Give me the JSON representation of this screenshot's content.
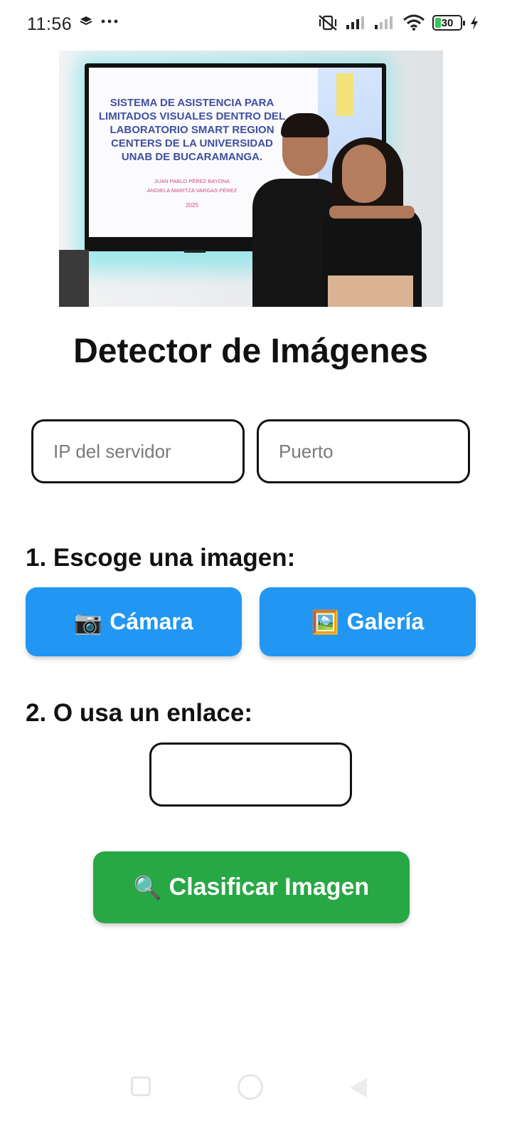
{
  "status_bar": {
    "time": "11:56",
    "battery": "30",
    "icons": [
      "layers-icon",
      "more-dots-icon",
      "vibrate-off-icon",
      "signal-icon",
      "signal-icon",
      "wifi-icon",
      "battery-icon",
      "charging-icon"
    ]
  },
  "hero_image": {
    "slide_title": "SISTEMA DE ASISTENCIA PARA LIMITADOS VISUALES DENTRO DEL LABORATORIO SMART REGION CENTERS DE LA UNIVERSIDAD UNAB DE BUCARAMANGA.",
    "slide_author_1": "JUAN PABLO PÉREZ BAYONA",
    "slide_author_2": "ANGIELA MARITZA VARGAS PÉREZ",
    "slide_year": "2025"
  },
  "page": {
    "title": "Detector de Imágenes"
  },
  "server": {
    "ip_placeholder": "IP del servidor",
    "ip_value": "",
    "port_placeholder": "Puerto",
    "port_value": ""
  },
  "step1": {
    "label": "1. Escoge una imagen:",
    "camera_icon": "📷",
    "camera_label": "Cámara",
    "gallery_icon": "🖼️",
    "gallery_label": "Galería"
  },
  "step2": {
    "label": "2. O usa un enlace:",
    "url_value": "",
    "url_placeholder": ""
  },
  "classify": {
    "icon": "🔍",
    "label": "Clasificar Imagen"
  },
  "colors": {
    "primary_blue": "#2196f3",
    "success_green": "#28a745"
  }
}
